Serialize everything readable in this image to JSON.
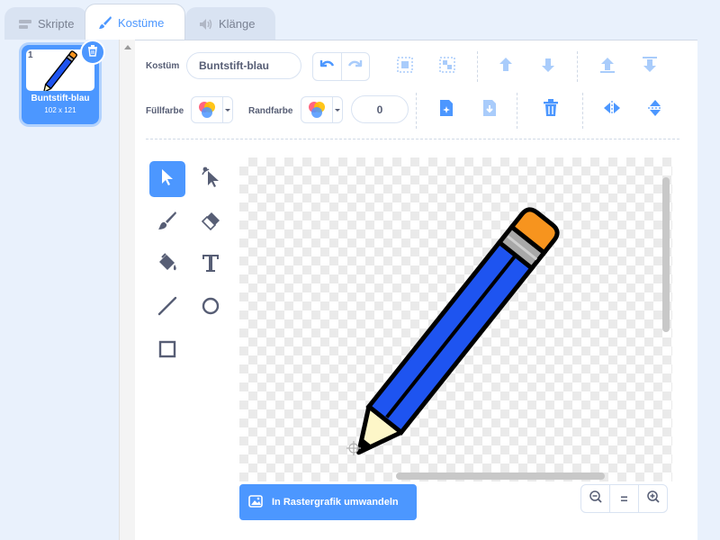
{
  "tabs": [
    {
      "label": "Skripte",
      "icon": "code-icon"
    },
    {
      "label": "Kostüme",
      "icon": "brush-icon",
      "active": true
    },
    {
      "label": "Klänge",
      "icon": "speaker-icon"
    }
  ],
  "costume_list": {
    "items": [
      {
        "number": "1",
        "name": "Buntstift-blau",
        "size": "102 x 121",
        "selected": true
      }
    ]
  },
  "editor": {
    "costume_label": "Kostüm",
    "costume_name": "Buntstift-blau",
    "fill_label": "Füllfarbe",
    "outline_label": "Randfarbe",
    "outline_width": "0",
    "convert_button": "In Rastergrafik umwandeln",
    "tools": [
      "select-tool",
      "reshape-tool",
      "brush-tool",
      "eraser-tool",
      "fill-tool",
      "text-tool",
      "line-tool",
      "circle-tool",
      "rectangle-tool"
    ],
    "active_tool": "select-tool",
    "zoom": {
      "out": "zoom-out-icon",
      "reset": "=",
      "in": "zoom-in-icon"
    }
  },
  "colors": {
    "accent": "#4c97ff",
    "pencil_body": "#1e54f0",
    "pencil_eraser": "#f7941e",
    "pencil_band": "#a8a8a8",
    "pencil_wood": "#fdf6c8"
  }
}
